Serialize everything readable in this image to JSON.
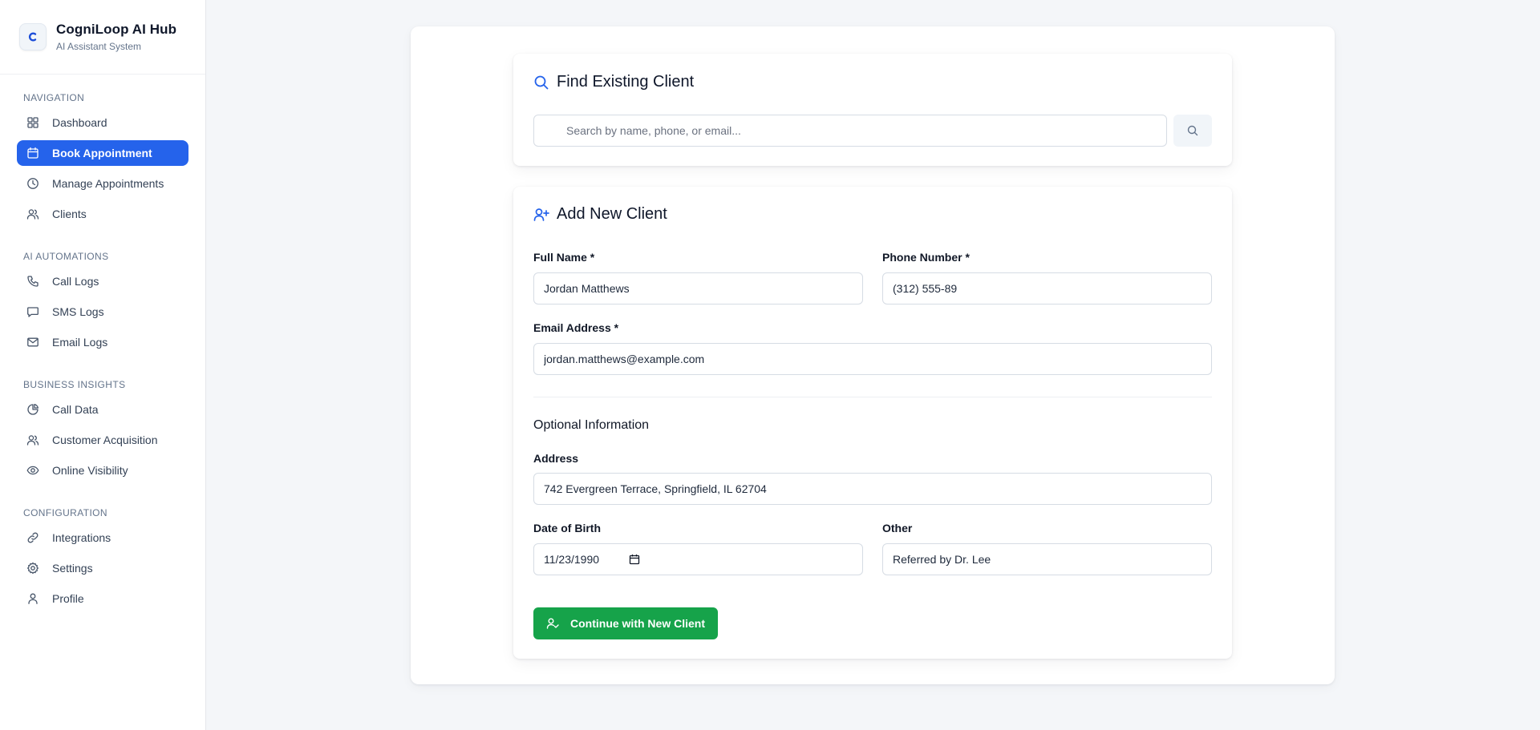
{
  "brand": {
    "logo_letter": "C",
    "title": "CogniLoop AI Hub",
    "subtitle": "AI Assistant System"
  },
  "sidebar": {
    "sections": [
      {
        "title": "NAVIGATION",
        "items": [
          {
            "label": "Dashboard",
            "icon": "grid-icon",
            "active": false
          },
          {
            "label": "Book Appointment",
            "icon": "calendar-icon",
            "active": true
          },
          {
            "label": "Manage Appointments",
            "icon": "clock-icon",
            "active": false
          },
          {
            "label": "Clients",
            "icon": "users-icon",
            "active": false
          }
        ]
      },
      {
        "title": "AI AUTOMATIONS",
        "items": [
          {
            "label": "Call Logs",
            "icon": "phone-icon",
            "active": false
          },
          {
            "label": "SMS Logs",
            "icon": "message-icon",
            "active": false
          },
          {
            "label": "Email Logs",
            "icon": "mail-icon",
            "active": false
          }
        ]
      },
      {
        "title": "BUSINESS INSIGHTS",
        "items": [
          {
            "label": "Call Data",
            "icon": "pie-chart-icon",
            "active": false
          },
          {
            "label": "Customer Acquisition",
            "icon": "users-icon",
            "active": false
          },
          {
            "label": "Online Visibility",
            "icon": "eye-icon",
            "active": false
          }
        ]
      },
      {
        "title": "CONFIGURATION",
        "items": [
          {
            "label": "Integrations",
            "icon": "link-icon",
            "active": false
          },
          {
            "label": "Settings",
            "icon": "gear-icon",
            "active": false
          },
          {
            "label": "Profile",
            "icon": "user-icon",
            "active": false
          }
        ]
      }
    ]
  },
  "find_client": {
    "title": "Find Existing Client",
    "search_placeholder": "Search by name, phone, or email..."
  },
  "new_client": {
    "title": "Add New Client",
    "full_name_label": "Full Name *",
    "full_name_value": "Jordan Matthews",
    "phone_label": "Phone Number *",
    "phone_value": "(312) 555-89",
    "email_label": "Email Address *",
    "email_value": "jordan.matthews@example.com",
    "optional_heading": "Optional Information",
    "address_label": "Address",
    "address_value": "742 Evergreen Terrace, Springfield, IL 62704",
    "dob_label": "Date of Birth",
    "dob_value": "11/23/1990",
    "other_label": "Other",
    "other_value": "Referred by Dr. Lee",
    "continue_label": "Continue with New Client"
  },
  "colors": {
    "accent": "#2563eb",
    "success": "#16a34a",
    "background": "#f4f6f9"
  }
}
